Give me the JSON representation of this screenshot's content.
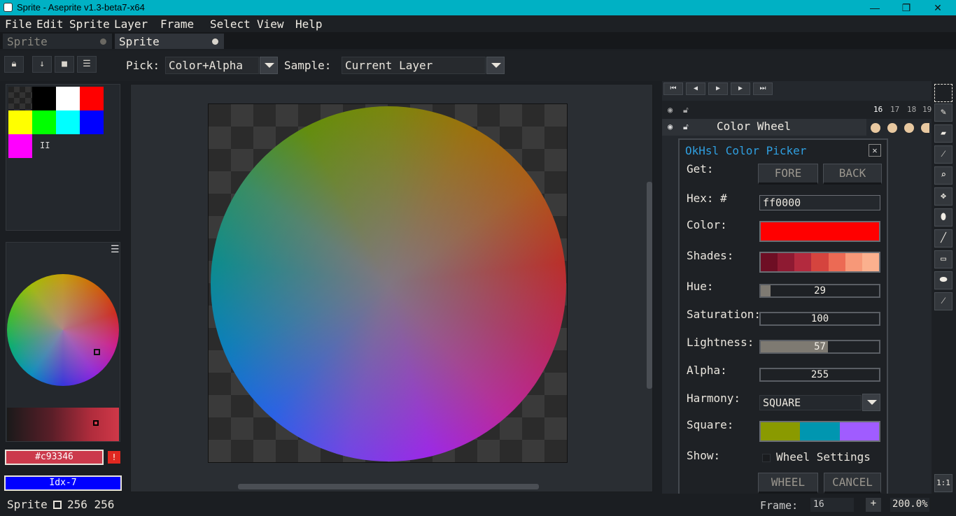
{
  "window": {
    "title": "Sprite - Aseprite v1.3-beta7-x64",
    "controls": {
      "minimize": "—",
      "maximize": "❐",
      "close": "✕"
    }
  },
  "menu": [
    "File",
    "Edit",
    "Sprite",
    "Layer",
    "Frame",
    "Select",
    "View",
    "Help"
  ],
  "tabs": [
    {
      "label": "Sprite",
      "active": false
    },
    {
      "label": "Sprite",
      "active": true
    }
  ],
  "toolbar": {
    "pick_label": "Pick:",
    "pick_value": "Color+Alpha",
    "sample_label": "Sample:",
    "sample_value": "Current Layer"
  },
  "palette": {
    "colors": [
      "#262626",
      "#000000",
      "#ffffff",
      "#ff0000",
      "#ffff00",
      "#00ff00",
      "#00ffff",
      "#0000ff",
      "#ff00ff"
    ],
    "pause_glyph": "II"
  },
  "color_bar": {
    "fg_hex": "#c93346",
    "fg_color": "#cb3a4c",
    "bg_label": "Idx-7",
    "bg_color": "#0000ff",
    "warning_glyph": "!"
  },
  "timeline": {
    "frame_numbers": [
      "16",
      "17",
      "18",
      "19"
    ],
    "layer_name": "Color Wheel",
    "cel_color": "#e8c8a0"
  },
  "dialog": {
    "title": "OkHsl Color Picker",
    "close_glyph": "✕",
    "get_label": "Get:",
    "fore_button": "FORE",
    "back_button": "BACK",
    "hex_label": "Hex: #",
    "hex_value": "ff0000",
    "color_label": "Color:",
    "color_value": "#ff0000",
    "shades_label": "Shades:",
    "shades": [
      "#6e0e24",
      "#8e1a32",
      "#b32a3e",
      "#d5443e",
      "#ec6a54",
      "#f79878",
      "#fbb08e"
    ],
    "hue_label": "Hue:",
    "hue": 29,
    "hue_fraction": 0.08,
    "saturation_label": "Saturation:",
    "saturation": 100,
    "saturation_fraction": 0.0,
    "lightness_label": "Lightness:",
    "lightness": 57,
    "lightness_fraction": 0.57,
    "alpha_label": "Alpha:",
    "alpha": 255,
    "alpha_fraction": 0.0,
    "harmony_label": "Harmony:",
    "harmony_value": "SQUARE",
    "square_label": "Square:",
    "square_colors": [
      "#8a9a00",
      "#0096b0",
      "#a05cff"
    ],
    "show_label": "Show:",
    "wheel_settings_label": "Wheel Settings",
    "wheel_settings_checked": false,
    "wheel_button": "WHEEL",
    "cancel_button": "CANCEL"
  },
  "status": {
    "sprite_label": "Sprite",
    "size": "256 256",
    "frame_label": "Frame:",
    "frame_value": "16",
    "plus_glyph": "+",
    "zoom": "200.0%"
  }
}
